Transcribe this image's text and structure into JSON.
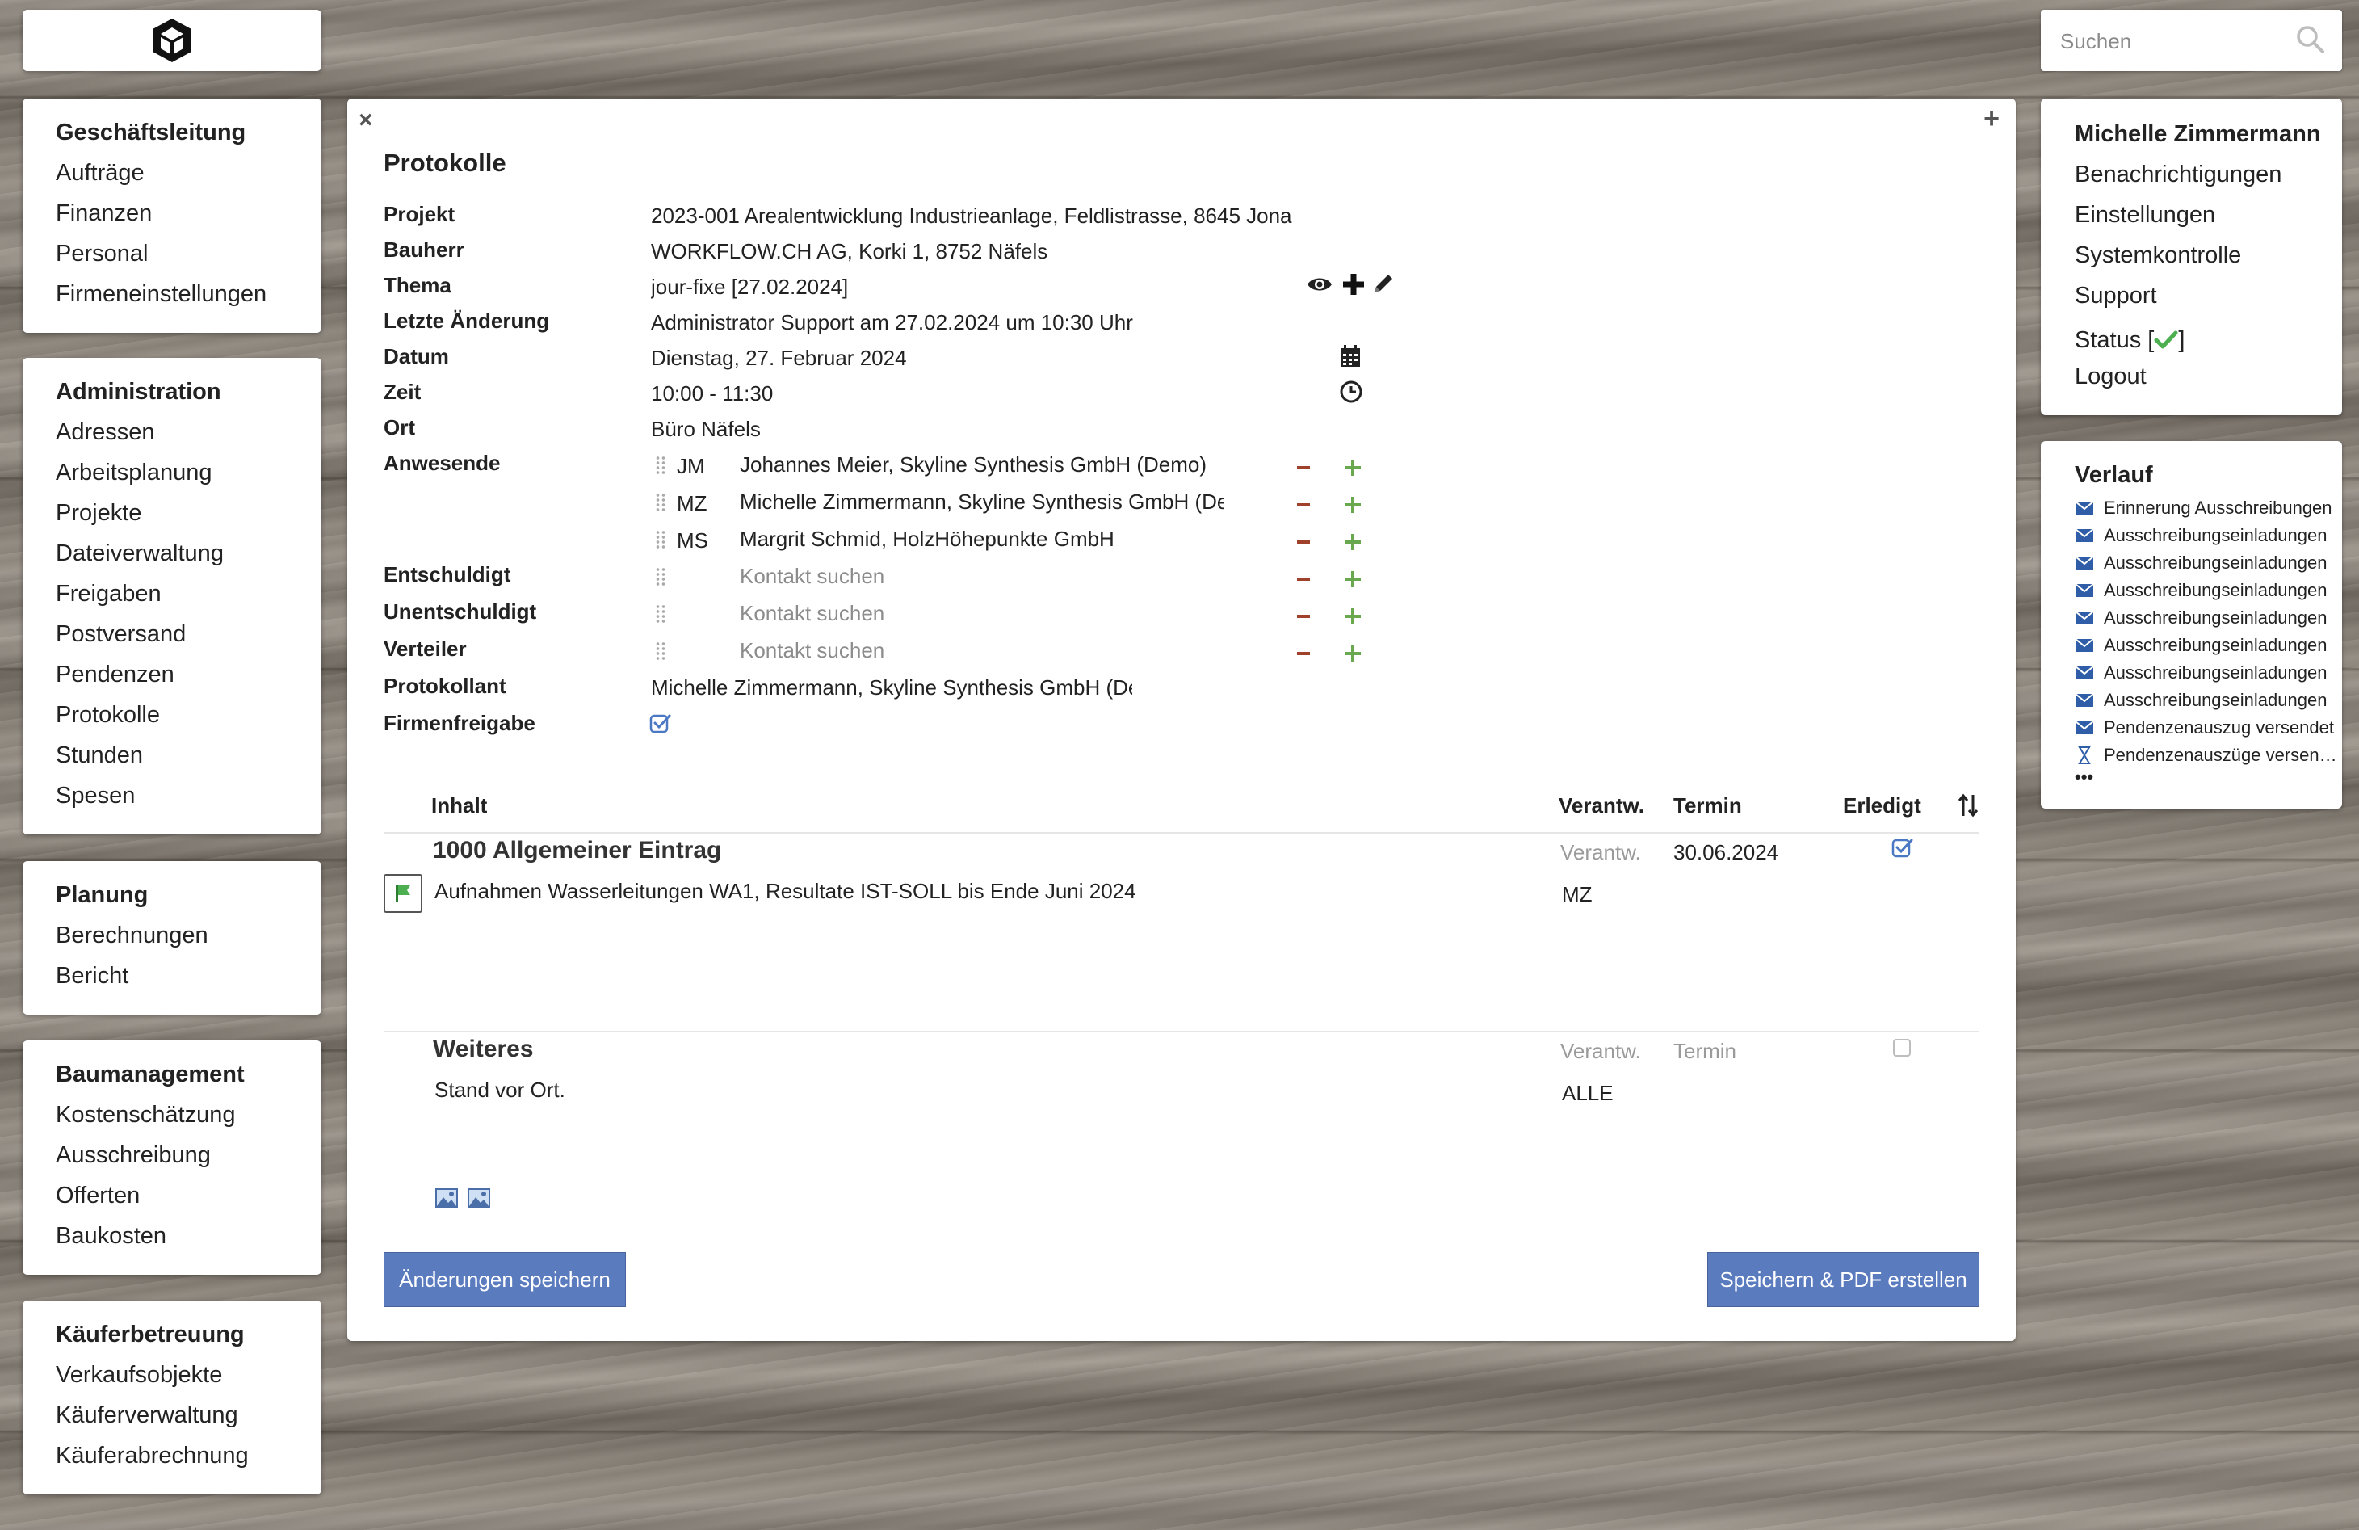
{
  "logo": {
    "icon": "cube-logo-icon"
  },
  "nav": {
    "groups": [
      {
        "title": "Geschäftsleitung",
        "items": [
          "Aufträge",
          "Finanzen",
          "Personal",
          "Firmeneinstellungen"
        ]
      },
      {
        "title": "Administration",
        "items": [
          "Adressen",
          "Arbeitsplanung",
          "Projekte",
          "Dateiverwaltung",
          "Freigaben",
          "Postversand",
          "Pendenzen",
          "Protokolle",
          "Stunden",
          "Spesen"
        ]
      },
      {
        "title": "Planung",
        "items": [
          "Berechnungen",
          "Bericht"
        ]
      },
      {
        "title": "Baumanagement",
        "items": [
          "Kostenschätzung",
          "Ausschreibung",
          "Offerten",
          "Baukosten"
        ]
      },
      {
        "title": "Käuferbetreuung",
        "items": [
          "Verkaufsobjekte",
          "Käuferverwaltung",
          "Käuferabrechnung"
        ]
      }
    ]
  },
  "search": {
    "placeholder": "Suchen"
  },
  "user": {
    "name": "Michelle Zimmermann",
    "links": [
      "Benachrichtigungen",
      "Einstellungen",
      "Systemkontrolle",
      "Support"
    ],
    "status_prefix": "Status [",
    "status_suffix": "]",
    "logout": "Logout"
  },
  "verlauf": {
    "title": "Verlauf",
    "items": [
      {
        "icon": "envelope-icon",
        "text": "Erinnerung Ausschreibungen"
      },
      {
        "icon": "envelope-icon",
        "text": "Ausschreibungseinladungen"
      },
      {
        "icon": "envelope-icon",
        "text": "Ausschreibungseinladungen"
      },
      {
        "icon": "envelope-icon",
        "text": "Ausschreibungseinladungen"
      },
      {
        "icon": "envelope-icon",
        "text": "Ausschreibungseinladungen"
      },
      {
        "icon": "envelope-icon",
        "text": "Ausschreibungseinladungen"
      },
      {
        "icon": "envelope-icon",
        "text": "Ausschreibungseinladungen"
      },
      {
        "icon": "envelope-icon",
        "text": "Ausschreibungseinladungen"
      },
      {
        "icon": "envelope-icon",
        "text": "Pendenzenauszug versendet"
      },
      {
        "icon": "hourglass-icon",
        "text": "Pendenzenauszüge versen…"
      }
    ],
    "more": "•••"
  },
  "protokoll": {
    "close": "×",
    "add": "+",
    "title": "Protokolle",
    "labels": {
      "projekt": "Projekt",
      "bauherr": "Bauherr",
      "thema": "Thema",
      "letzte": "Letzte Änderung",
      "datum": "Datum",
      "zeit": "Zeit",
      "ort": "Ort",
      "anwesende": "Anwesende",
      "entschuldigt": "Entschuldigt",
      "unentschuldigt": "Unentschuldigt",
      "verteiler": "Verteiler",
      "protokollant": "Protokollant",
      "firmenfreigabe": "Firmenfreigabe"
    },
    "values": {
      "projekt": "2023-001 Arealentwicklung Industrieanlage, Feldlistrasse, 8645 Jona",
      "bauherr": "WORKFLOW.CH AG, Korki 1, 8752 Näfels",
      "thema": "jour-fixe [27.02.2024]",
      "letzte": "Administrator Support am 27.02.2024 um 10:30 Uhr",
      "datum": "Dienstag, 27. Februar 2024",
      "zeit": "10:00 - 11:30",
      "ort": "Büro Näfels",
      "protokollant": "Michelle Zimmermann, Skyline Synthesis GmbH (Demo)"
    },
    "anwesende": [
      {
        "initials": "JM",
        "name": "Johannes Meier, Skyline Synthesis GmbH (Demo)"
      },
      {
        "initials": "MZ",
        "name": "Michelle Zimmermann, Skyline Synthesis GmbH (Demo)"
      },
      {
        "initials": "MS",
        "name": "Margrit Schmid, HolzHöhepunkte GmbH"
      }
    ],
    "kontakt_placeholder": "Kontakt suchen",
    "table": {
      "headers": {
        "inhalt": "Inhalt",
        "verantw": "Verantw.",
        "termin": "Termin",
        "erledigt": "Erledigt"
      },
      "entries": [
        {
          "title": "1000 Allgemeiner Eintrag",
          "verantw_placeholder": "Verantw.",
          "termin": "30.06.2024",
          "text": "Aufnahmen Wasserleitungen WA1, Resultate IST-SOLL bis Ende Juni 2024",
          "verantw": "MZ",
          "erledigt": true
        },
        {
          "title": "Weiteres",
          "verantw_placeholder": "Verantw.",
          "termin_placeholder": "Termin",
          "text": "Stand vor Ort.",
          "verantw": "ALLE",
          "erledigt": false
        }
      ]
    },
    "buttons": {
      "save": "Änderungen speichern",
      "pdf": "Speichern & PDF erstellen"
    }
  },
  "colors": {
    "accent": "#5b7bbf",
    "plus": "#6aa84f",
    "minus": "#a0412b",
    "check": "#4a78c2",
    "status_ok": "#4caf50"
  }
}
